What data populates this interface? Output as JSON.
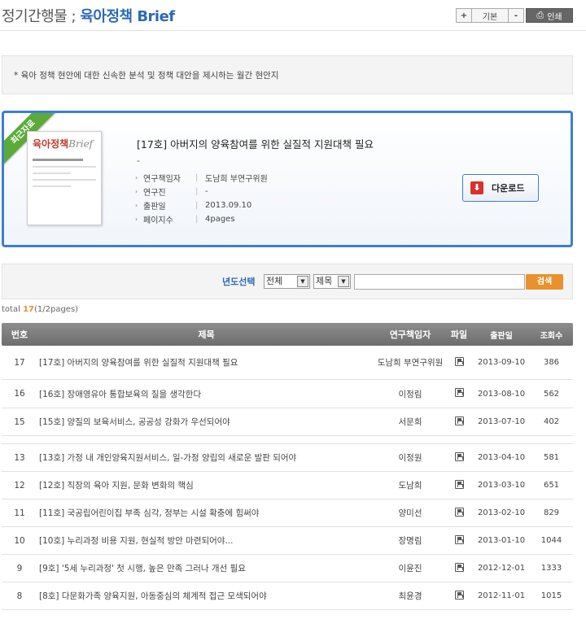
{
  "header": {
    "title_prefix": "정기간행물 ;",
    "title_main": "육아정책 Brief",
    "toolbar": {
      "plus": "+",
      "basic": "기본",
      "minus": "-",
      "print": "인쇄"
    }
  },
  "intro": {
    "text": "* 육아 정책 현안에 대한 신속한 분석 및 정책 대안을 제시하는 월간 현안지"
  },
  "featured": {
    "ribbon": "최근자료",
    "thumb_brand": "육아정책",
    "thumb_brand_suffix": "Brief",
    "title": "[17호] 아버지의 양육참여를 위한 실질적 지원대책 필요",
    "dash": "-",
    "meta": [
      {
        "label": "연구책임자",
        "value": "도남희 부연구위원"
      },
      {
        "label": "연구진",
        "value": "-"
      },
      {
        "label": "출판일",
        "value": "2013.09.10"
      },
      {
        "label": "페이지수",
        "value": "4pages"
      }
    ],
    "download_label": "다운로드"
  },
  "search": {
    "label": "년도선택",
    "year_value": "전체",
    "field_value": "제목",
    "input_value": "",
    "button_label": "검색"
  },
  "total": {
    "prefix": "total",
    "count": "17",
    "pages": "(1/2pages)"
  },
  "table": {
    "headers": {
      "no": "번호",
      "title": "제목",
      "author": "연구책임자",
      "file": "파일",
      "date": "출판일",
      "views": "조회수"
    },
    "rows": [
      {
        "no": "17",
        "title": "[17호] 아버지의 양육참여를 위한 실질적 지원대책 필요",
        "author": "도남희 부연구위원",
        "date": "2013-09-10",
        "views": "386"
      },
      {
        "no": "16",
        "title": "[16호] 장애영유아 통합보육의 질을 생각한다",
        "author": "이정림",
        "date": "2013-08-10",
        "views": "562"
      },
      {
        "no": "15",
        "title": "[15호] 양질의 보육서비스, 공공성 강화가 우선되어야",
        "author": "서문희",
        "date": "2013-07-10",
        "views": "402"
      },
      {
        "no": "13",
        "title": "[13호] 가정 내 개인양육지원서비스, 일-가정 양립의 새로운 발판 되어야",
        "author": "이정원",
        "date": "2013-04-10",
        "views": "581"
      },
      {
        "no": "12",
        "title": "[12호] 직장의 육아 지원, 문화 변화의 핵심",
        "author": "도남희",
        "date": "2013-03-10",
        "views": "651"
      },
      {
        "no": "11",
        "title": "[11호] 국공립어린이집 부족 심각, 정부는 시설 확충에 힘써야",
        "author": "양미선",
        "date": "2013-02-10",
        "views": "829"
      },
      {
        "no": "10",
        "title": "[10호] 누리과정 비용 지원, 현실적 방안 마련되어야...",
        "author": "장명림",
        "date": "2013-01-10",
        "views": "1044"
      },
      {
        "no": "9",
        "title": "[9호] '5세 누리과정' 첫 시행, 높은 만족 그러나 개선 필요",
        "author": "이윤진",
        "date": "2012-12-01",
        "views": "1333"
      },
      {
        "no": "8",
        "title": "[8호] 다문화가족 양육지원, 아동중심의 체계적 접근 모색되어야",
        "author": "최윤경",
        "date": "2012-11-01",
        "views": "1015"
      }
    ]
  }
}
